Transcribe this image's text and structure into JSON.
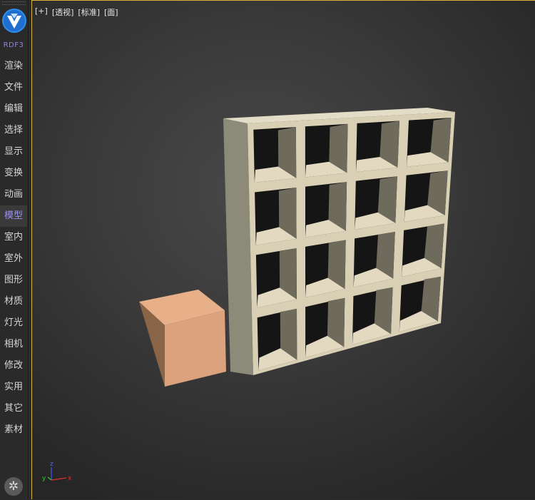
{
  "sidebar": {
    "brand": "RDF3",
    "items": [
      {
        "label": "渲染",
        "icon": "render"
      },
      {
        "label": "文件",
        "icon": "file"
      },
      {
        "label": "编辑",
        "icon": "edit"
      },
      {
        "label": "选择",
        "icon": "select"
      },
      {
        "label": "显示",
        "icon": "display"
      },
      {
        "label": "变换",
        "icon": "transform"
      },
      {
        "label": "动画",
        "icon": "animation"
      },
      {
        "label": "模型",
        "icon": "model",
        "active": true
      },
      {
        "label": "室内",
        "icon": "interior"
      },
      {
        "label": "室外",
        "icon": "exterior"
      },
      {
        "label": "图形",
        "icon": "shapes"
      },
      {
        "label": "材质",
        "icon": "material"
      },
      {
        "label": "灯光",
        "icon": "light"
      },
      {
        "label": "相机",
        "icon": "camera"
      },
      {
        "label": "修改",
        "icon": "modify"
      },
      {
        "label": "实用",
        "icon": "utilities"
      },
      {
        "label": "其它",
        "icon": "other"
      },
      {
        "label": "素材",
        "icon": "assets"
      }
    ],
    "settings_icon": "gear-icon"
  },
  "viewport": {
    "labels": [
      "[+]",
      "[透视]",
      "[标准]",
      "[面]"
    ],
    "axis": {
      "z": "z",
      "x": "x",
      "y": "y"
    },
    "colors": {
      "active_border": "#d8b23a",
      "cube": "#e2a47c",
      "shelf": "#d9cfb4"
    }
  }
}
